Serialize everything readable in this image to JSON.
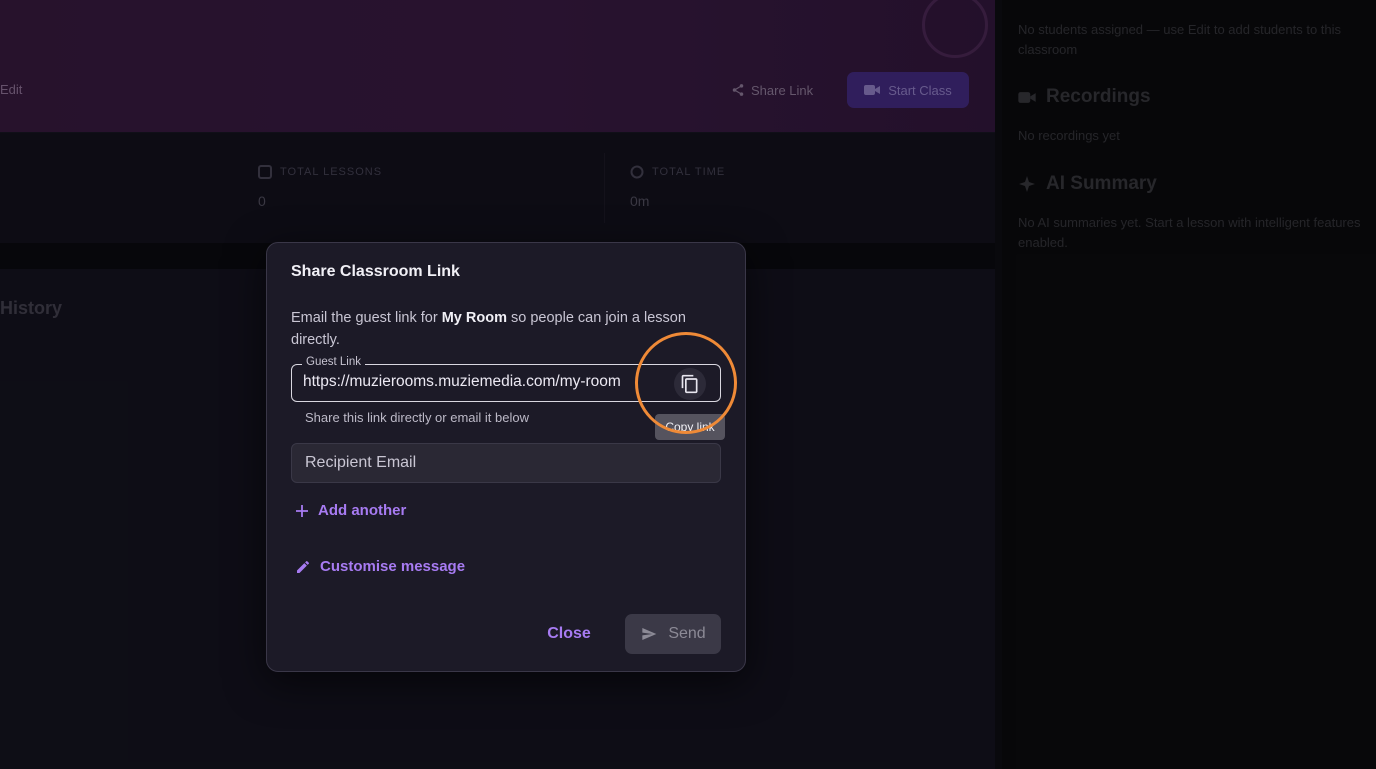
{
  "background": {
    "hero": {
      "edit_label": "Edit",
      "share_link_label": "Share Link",
      "start_class_label": "Start Class"
    },
    "stats": [
      {
        "label": "TOTAL LESSONS",
        "value": "0",
        "icon": "book-icon"
      },
      {
        "label": "TOTAL TIME",
        "value": "0m",
        "icon": "clock-icon"
      }
    ],
    "history_title": "History",
    "right_panel": {
      "students_text": "No students assigned — use Edit to add students to this classroom",
      "recordings_title": "Recordings",
      "recordings_text": "No recordings yet",
      "ai_summary_title": "AI Summary",
      "ai_summary_text": "No AI summaries yet. Start a lesson with intelligent features enabled."
    }
  },
  "dialog": {
    "title": "Share Classroom Link",
    "description_prefix": "Email the guest link for ",
    "room_name": "My Room",
    "description_suffix": " so people can join a lesson directly.",
    "guest_link_label": "Guest Link",
    "guest_link_value": "https://muzierooms.muziemedia.com/my-room",
    "helper_text": "Share this link directly or email it below",
    "copy_tooltip": "Copy link",
    "recipient_placeholder": "Recipient Email",
    "add_another_label": "Add another",
    "customise_message_label": "Customise message",
    "close_label": "Close",
    "send_label": "Send"
  },
  "colors": {
    "accent": "#a77bf2",
    "highlight_ring": "#ef8a37",
    "dialog_bg": "#1c1a27",
    "hero_purple": "#3e1d49"
  }
}
